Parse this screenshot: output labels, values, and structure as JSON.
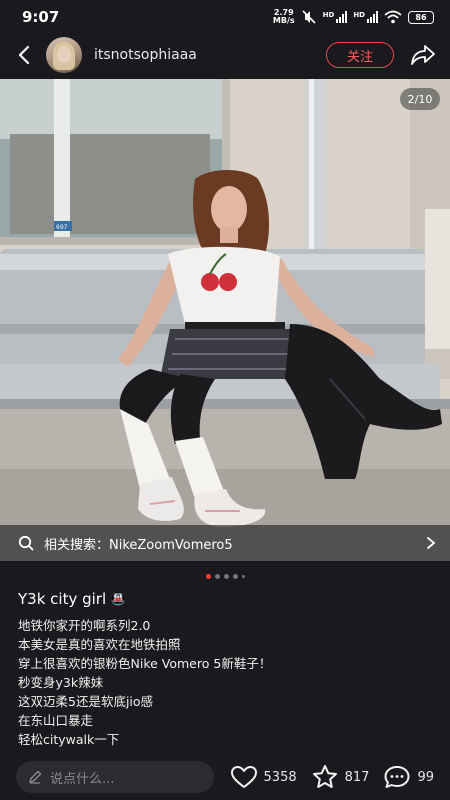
{
  "status_bar": {
    "time": "9:07",
    "net_speed_value": "2.79",
    "net_speed_unit": "MB/s",
    "signal_1_label": "HD",
    "signal_2_label": "HD",
    "battery": "86"
  },
  "header": {
    "username": "itsnotsophiaaa",
    "follow_label": "关注"
  },
  "photo": {
    "page_counter": "2/10",
    "related_search": "相关搜索：NikeZoomVomero5",
    "station_sign": "697"
  },
  "post": {
    "title": "Y3k city girl",
    "title_emoji": "🚇",
    "lines": [
      "地铁你家开的啊系列2.0",
      "本美女是真的喜欢在地铁拍照",
      "穿上很喜欢的银粉色Nike Vomero 5新鞋子！",
      "秒变身y3k辣妹",
      "这双迈柔5还是软底jio感",
      "在东山口暴走",
      "轻松citywalk一下"
    ]
  },
  "bottom_bar": {
    "comment_placeholder": "说点什么...",
    "likes": "5358",
    "favorites": "817",
    "comments": "99"
  },
  "colors": {
    "background": "#1a1a1e",
    "accent": "#ff3b3b",
    "follow_border": "#e04a4a"
  }
}
